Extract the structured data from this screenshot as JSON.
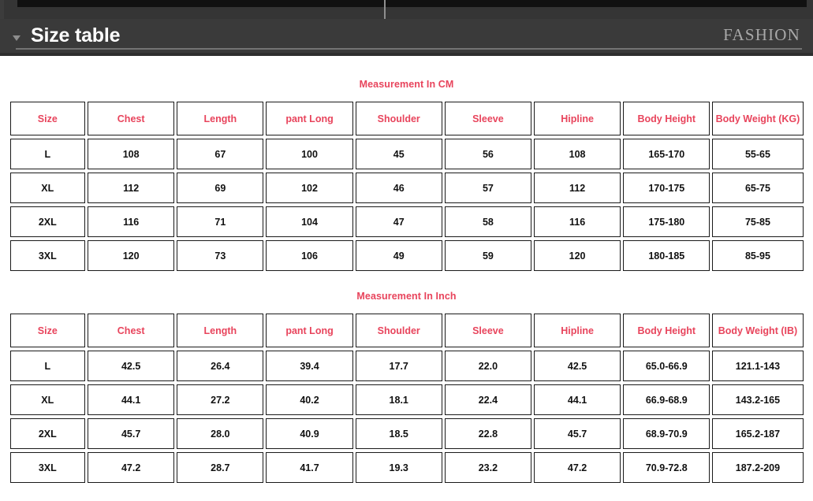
{
  "header": {
    "title": "Size table",
    "brand": "FASHION",
    "collapse_icon": "chevron-down-icon",
    "background_color": "#3a3a3a",
    "title_color": "#ffffff",
    "brand_color": "#a9a9a9"
  },
  "accent_color": "#e8445c",
  "tables": [
    {
      "caption": "Measurement In CM",
      "columns": [
        "Size",
        "Chest",
        "Length",
        "pant Long",
        "Shoulder",
        "Sleeve",
        "Hipline",
        "Body Height",
        "Body Weight (KG)"
      ],
      "rows": [
        [
          "L",
          "108",
          "67",
          "100",
          "45",
          "56",
          "108",
          "165-170",
          "55-65"
        ],
        [
          "XL",
          "112",
          "69",
          "102",
          "46",
          "57",
          "112",
          "170-175",
          "65-75"
        ],
        [
          "2XL",
          "116",
          "71",
          "104",
          "47",
          "58",
          "116",
          "175-180",
          "75-85"
        ],
        [
          "3XL",
          "120",
          "73",
          "106",
          "49",
          "59",
          "120",
          "180-185",
          "85-95"
        ]
      ]
    },
    {
      "caption": "Measurement In Inch",
      "columns": [
        "Size",
        "Chest",
        "Length",
        "pant Long",
        "Shoulder",
        "Sleeve",
        "Hipline",
        "Body Height",
        "Body Weight (IB)"
      ],
      "rows": [
        [
          "L",
          "42.5",
          "26.4",
          "39.4",
          "17.7",
          "22.0",
          "42.5",
          "65.0-66.9",
          "121.1-143"
        ],
        [
          "XL",
          "44.1",
          "27.2",
          "40.2",
          "18.1",
          "22.4",
          "44.1",
          "66.9-68.9",
          "143.2-165"
        ],
        [
          "2XL",
          "45.7",
          "28.0",
          "40.9",
          "18.5",
          "22.8",
          "45.7",
          "68.9-70.9",
          "165.2-187"
        ],
        [
          "3XL",
          "47.2",
          "28.7",
          "41.7",
          "19.3",
          "23.2",
          "47.2",
          "70.9-72.8",
          "187.2-209"
        ]
      ]
    }
  ]
}
